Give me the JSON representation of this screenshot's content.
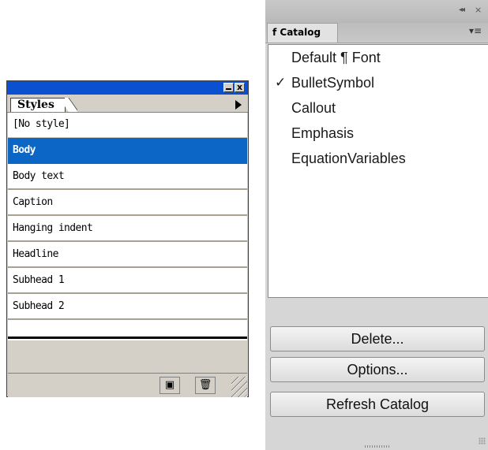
{
  "styles_panel": {
    "tab_label": "Styles",
    "close_glyph": "x",
    "items": [
      {
        "label": "[No style]",
        "selected": false
      },
      {
        "label": "Body",
        "selected": true
      },
      {
        "label": "Body text",
        "selected": false
      },
      {
        "label": "Caption",
        "selected": false
      },
      {
        "label": "Hanging indent",
        "selected": false
      },
      {
        "label": "Headline",
        "selected": false
      },
      {
        "label": "Subhead 1",
        "selected": false
      },
      {
        "label": "Subhead 2",
        "selected": false
      }
    ],
    "new_style_glyph": "▣",
    "delete_style_glyph": "🗑",
    "colors": {
      "titlebar": "#0a50d0",
      "selection": "#0b66c6"
    }
  },
  "catalog_panel": {
    "collapse_glyph": "◂◂",
    "close_glyph": "×",
    "tab_label": "f Catalog",
    "menu_glyph": "▾≡",
    "items": [
      {
        "label": "Default ¶ Font",
        "checked": false
      },
      {
        "label": "BulletSymbol",
        "checked": true
      },
      {
        "label": "Callout",
        "checked": false
      },
      {
        "label": "Emphasis",
        "checked": false
      },
      {
        "label": "EquationVariables",
        "checked": false
      }
    ],
    "check_glyph": "✓",
    "buttons": {
      "delete": "Delete...",
      "options": "Options...",
      "refresh": "Refresh Catalog"
    }
  }
}
